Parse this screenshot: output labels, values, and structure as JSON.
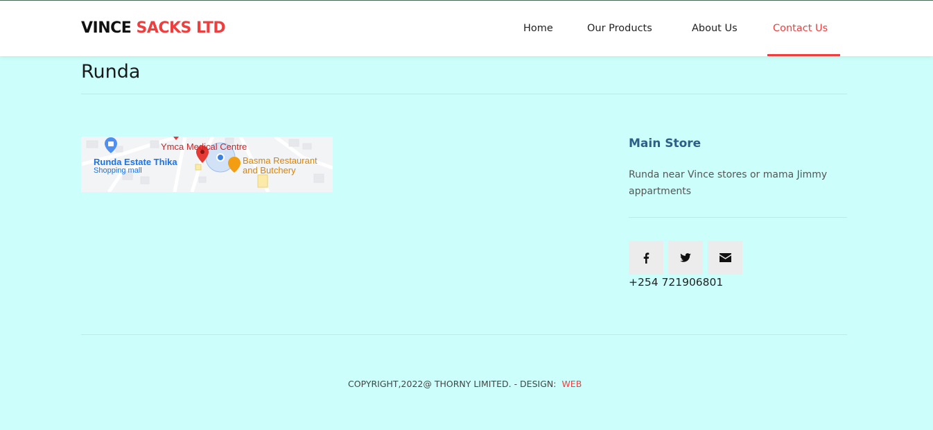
{
  "brand": {
    "name_part1": "VINCE",
    "name_part2": "SACKS LTD"
  },
  "nav": {
    "items": [
      {
        "label": "Home"
      },
      {
        "label": "Our Products"
      },
      {
        "label": "About Us"
      },
      {
        "label": "Contact Us",
        "active": true
      }
    ]
  },
  "page": {
    "title": "Runda"
  },
  "map": {
    "labels": {
      "ymca": "Ymca Medical Centre",
      "runda_estate": "Runda Estate Thika",
      "shopping_mall": "Shopping mall",
      "basma_line1": "Basma Restaurant",
      "basma_line2": "and Butchery"
    }
  },
  "store": {
    "title": "Main Store",
    "address": "Runda near Vince stores or mama Jimmy appartments",
    "phone": "+254 721906801"
  },
  "social": {
    "icons": [
      "facebook-icon",
      "twitter-icon",
      "envelope-icon"
    ]
  },
  "footer": {
    "copyright": "COPYRIGHT,2022@ THORNY LIMITED. - DESIGN:",
    "design_link": "WEB"
  },
  "colors": {
    "accent": "#ee3e3e",
    "background": "#ccfffb",
    "store_title": "#2e5f8a"
  }
}
